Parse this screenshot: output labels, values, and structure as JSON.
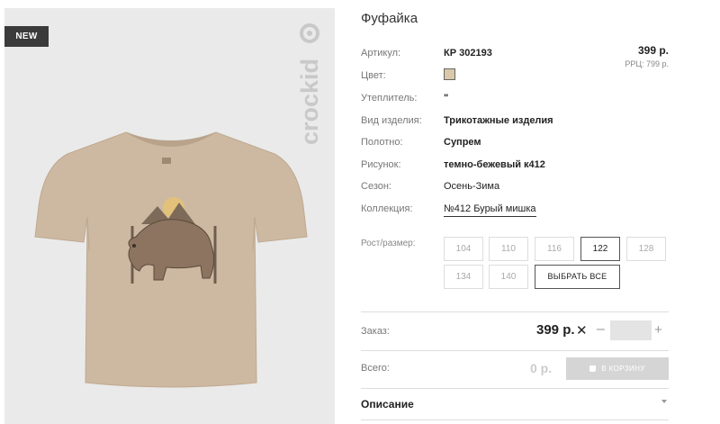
{
  "product": {
    "badge": "NEW",
    "brand": "crockid",
    "title": "Фуфайка",
    "price": "399 р.",
    "rrc": "РРЦ: 799 р.",
    "swatch_color": "#d9c9a8"
  },
  "specs": [
    {
      "label": "Артикул:",
      "value": "КР 302193"
    },
    {
      "label": "Цвет:",
      "value": ""
    },
    {
      "label": "Утеплитель:",
      "value": "\""
    },
    {
      "label": "Вид изделия:",
      "value": "Трикотажные изделия"
    },
    {
      "label": "Полотно:",
      "value": "Супрем"
    },
    {
      "label": "Рисунок:",
      "value": "темно-бежевый к412"
    },
    {
      "label": "Сезон:",
      "value": "Осень-Зима"
    },
    {
      "label": "Коллекция:",
      "value": "№412 Бурый мишка"
    }
  ],
  "sizes": {
    "label": "Рост/размер:",
    "options": [
      "104",
      "110",
      "116",
      "122",
      "128",
      "134",
      "140"
    ],
    "selected": "122",
    "select_all": "ВЫБРАТЬ ВСЕ"
  },
  "order": {
    "label": "Заказ:",
    "price": "399 р.",
    "times": "✕",
    "minus": "–",
    "plus": "+",
    "quantity": ""
  },
  "total": {
    "label": "Всего:",
    "value": "0 р.",
    "cart_button": "В КОРЗИНУ"
  },
  "description": {
    "label": "Описание"
  }
}
